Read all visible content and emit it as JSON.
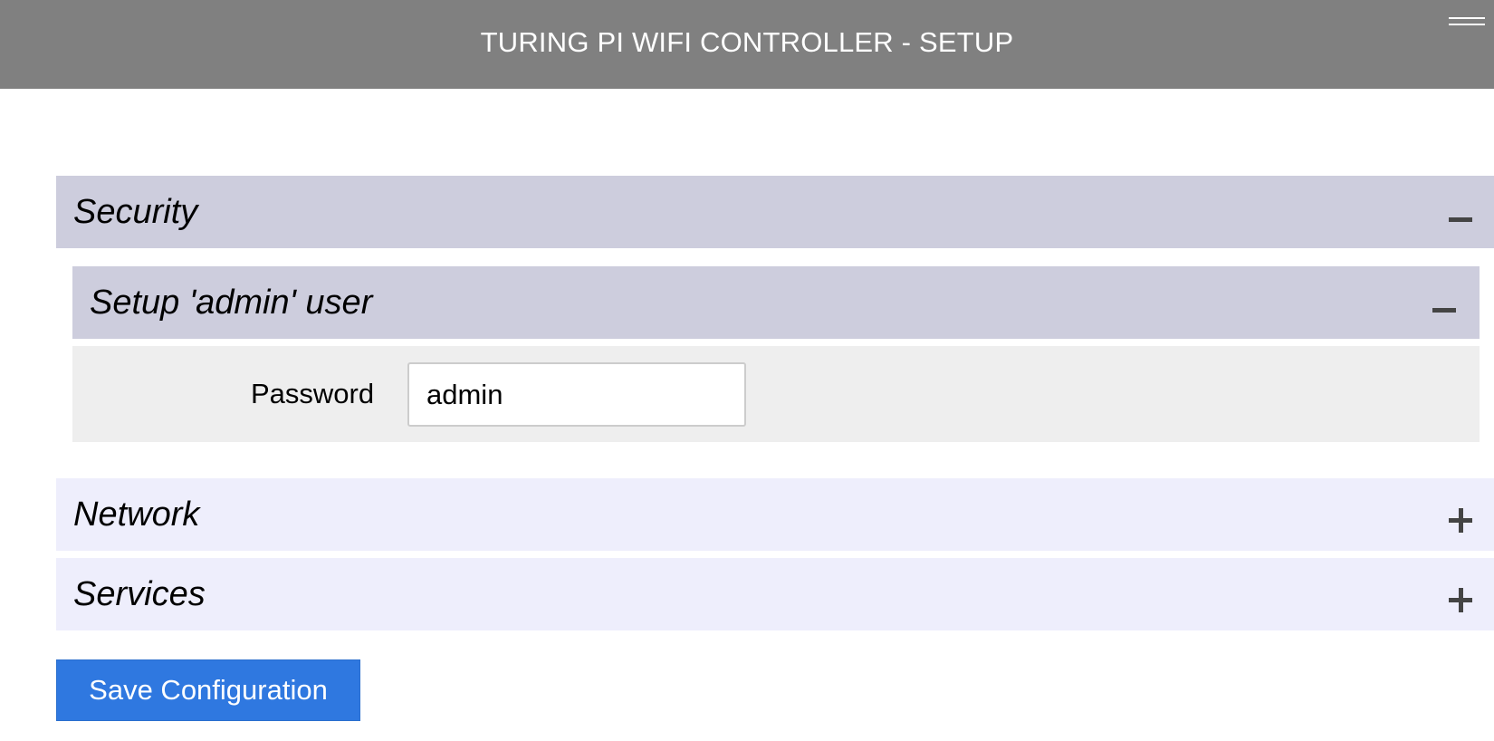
{
  "header": {
    "title": "TURING PI WIFI CONTROLLER - SETUP",
    "menu_icon": "hamburger-menu-icon"
  },
  "sections": {
    "security": {
      "label": "Security",
      "state": "expanded",
      "toggle_icon": "minus-icon",
      "subsections": {
        "admin_user": {
          "label": "Setup 'admin' user",
          "state": "expanded",
          "toggle_icon": "minus-icon",
          "fields": {
            "password": {
              "label": "Password",
              "value": "admin"
            }
          }
        }
      }
    },
    "network": {
      "label": "Network",
      "state": "collapsed",
      "toggle_icon": "plus-icon"
    },
    "services": {
      "label": "Services",
      "state": "collapsed",
      "toggle_icon": "plus-icon"
    }
  },
  "actions": {
    "save_label": "Save Configuration"
  },
  "colors": {
    "header_bg": "#808080",
    "expanded_section_bg": "#cdcddd",
    "collapsed_section_bg": "#eeeefc",
    "field_panel_bg": "#eeeeee",
    "primary_button": "#2f78e0"
  }
}
